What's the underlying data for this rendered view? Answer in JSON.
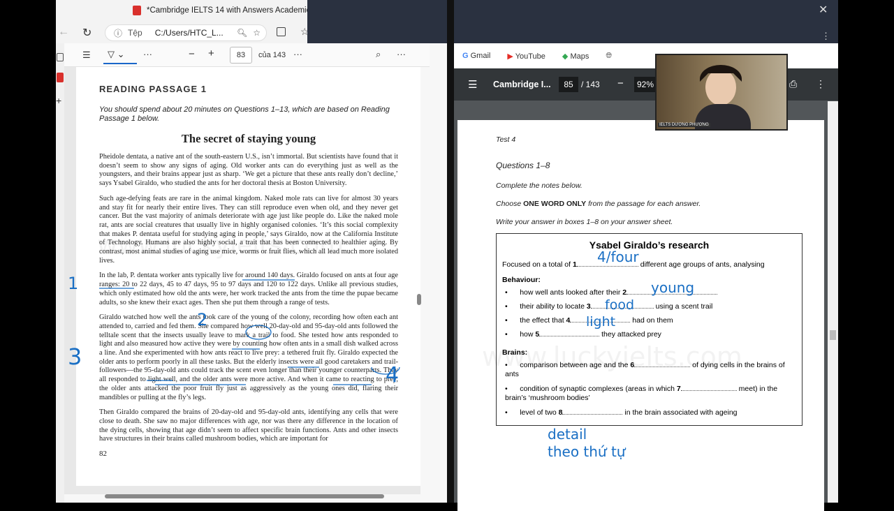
{
  "left_browser": {
    "tab_title": "*Cambridge IELTS 14 with Answers Academic [www.lu",
    "address_prefix": "Tệp",
    "address": "C:/Users/HTC_L...",
    "pdf_page": "83",
    "pdf_total": "của 143"
  },
  "passage": {
    "heading": "READING PASSAGE 1",
    "instruction": "You should spend about 20 minutes on Questions 1–13, which are based on Reading Passage 1 below.",
    "title": "The secret of staying young",
    "paragraphs": [
      "Pheidole dentata, a native ant of the south-eastern U.S., isn’t immortal. But scientists have found that it doesn’t seem to show any signs of aging. Old worker ants can do everything just as well as the youngsters, and their brains appear just as sharp. ‘We get a picture that these ants really don’t decline,’ says Ysabel Giraldo, who studied the ants for her doctoral thesis at Boston University.",
      "Such age-defying feats are rare in the animal kingdom. Naked mole rats can live for almost 30 years and stay fit for nearly their entire lives. They can still reproduce even when old, and they never get cancer. But the vast majority of animals deteriorate with age just like people do. Like the naked mole rat, ants are social creatures that usually live in highly organised colonies. ‘It’s this social complexity that makes P. dentata useful for studying aging in people,’ says Giraldo, now at the California Institute of Technology. Humans are also highly social, a trait that has been connected to healthier aging. By contrast, most animal studies of aging use mice, worms or fruit flies, which all lead much more isolated lives.",
      "In the lab, P. dentata worker ants typically live for around 140 days. Giraldo focused on ants at four age ranges: 20 to 22 days, 45 to 47 days, 95 to 97 days and 120 to 122 days. Unlike all previous studies, which only estimated how old the ants were, her work tracked the ants from the time the pupae became adults, so she knew their exact ages. Then she put them through a range of tests.",
      "Giraldo watched how well the ants took care of the young of the colony, recording how often each ant attended to, carried and fed them. She compared how well 20-day-old and 95-day-old ants followed the telltale scent that the insects usually leave to mark a trail to food. She tested how ants responded to light and also measured how active they were by counting how often ants in a small dish walked across a line. And she experimented with how ants react to live prey: a tethered fruit fly. Giraldo expected the older ants to perform poorly in all these tasks. But the elderly insects were all good caretakers and trail-followers—the 95-day-old ants could track the scent even longer than their younger counterparts. They all responded to light well, and the older ants were more active. And when it came to reacting to prey, the older ants attacked the poor fruit fly just as aggressively as the young ones did, flaring their mandibles or pulling at the fly’s legs.",
      "Then Giraldo compared the brains of 20-day-old and 95-day-old ants, identifying any cells that were close to death. She saw no major differences with age, nor was there any difference in the location of the dying cells, showing that age didn’t seem to affect specific brain functions. Ants and other insects have structures in their brains called mushroom bodies, which are important for"
    ],
    "page_number": "82",
    "watermark": "www.luckyielts.com"
  },
  "annotations_left": {
    "n1": "1",
    "n2": "2",
    "n3": "3",
    "n4": "4"
  },
  "right_browser": {
    "bookmarks": [
      "Gmail",
      "YouTube",
      "Maps"
    ],
    "doc_title": "Cambridge I...",
    "page": "85",
    "total": "/ 143",
    "zoom": "92%"
  },
  "test": {
    "label": "Test 4",
    "questions": "Questions 1–8",
    "inst1": "Complete the notes below.",
    "inst2_a": "Choose ",
    "inst2_b": "ONE WORD ONLY",
    "inst2_c": " from the passage for each answer.",
    "inst3": "Write your answer in boxes 1–8 on your answer sheet.",
    "box_title": "Ysabel Giraldo’s research",
    "line1_a": "Focused on a total of ",
    "line1_num": "1",
    "line1_b": " different age groups of ants, analysing",
    "behaviour": "Behaviour:",
    "b1_a": "how well ants looked after their ",
    "b1_num": "2",
    "b2_a": "their ability to locate ",
    "b2_num": "3",
    "b2_b": " using a scent trail",
    "b3_a": "the effect that ",
    "b3_num": "4",
    "b3_b": " had on them",
    "b4_a": "how ",
    "b4_num": "5",
    "b4_b": " they attacked prey",
    "brains": "Brains:",
    "r1_a": "comparison between age and the ",
    "r1_num": "6",
    "r1_b": " of dying cells in the brains of ants",
    "r2_a": "condition of synaptic complexes (areas in which ",
    "r2_num": "7",
    "r2_b": " meet) in the brain’s ‘mushroom bodies’",
    "r3_a": "level of two ",
    "r3_num": "8",
    "r3_b": " in the brain associated with ageing",
    "watermark": "www.luckyielts.com"
  },
  "handwriting": {
    "a1": "4/four",
    "a2": "young",
    "a3": "food",
    "a4": "light",
    "note1": "detail",
    "note2": "theo thứ tự"
  },
  "webcam": {
    "caption": "IELTS DƯƠNG PHƯƠNG"
  }
}
